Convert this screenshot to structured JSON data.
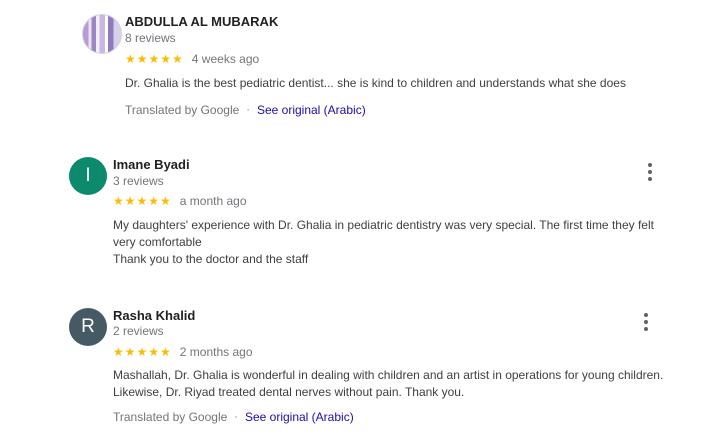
{
  "reviews": [
    {
      "name": "ABDULLA AL MUBARAK",
      "count": "8 reviews",
      "stars": "★★★★★",
      "when": "4 weeks ago",
      "text": [
        "Dr. Ghalia is the best pediatric dentist... she is kind to children and understands what she does"
      ],
      "translated_label": "Translated by Google",
      "separator": "·",
      "see_original": "See original (Arabic)",
      "avatar_initial": ""
    },
    {
      "name": "Imane Byadi",
      "count": "3 reviews",
      "stars": "★★★★★",
      "when": "a month ago",
      "text": [
        "My daughters' experience with Dr. Ghalia in pediatric dentistry was very special. The first time they felt",
        "very comfortable",
        "Thank you to the doctor and the staff"
      ],
      "avatar_initial": "I",
      "avatar_color": "#0b8a6c"
    },
    {
      "name": "Rasha Khalid",
      "count": "2 reviews",
      "stars": "★★★★★",
      "when": "2 months ago",
      "text": [
        "Mashallah, Dr. Ghalia is wonderful in dealing with children and an artist in operations for young children.",
        "Likewise, Dr. Riyad treated dental nerves without pain. Thank you."
      ],
      "translated_label": "Translated by Google",
      "separator": "·",
      "see_original": "See original (Arabic)",
      "avatar_initial": "R",
      "avatar_color": "#455a64"
    }
  ],
  "icons": {
    "more": "more-vert-icon",
    "star": "star-icon"
  },
  "colors": {
    "star": "#fbbc04",
    "link": "#1a0dab",
    "meta": "#70757a"
  }
}
